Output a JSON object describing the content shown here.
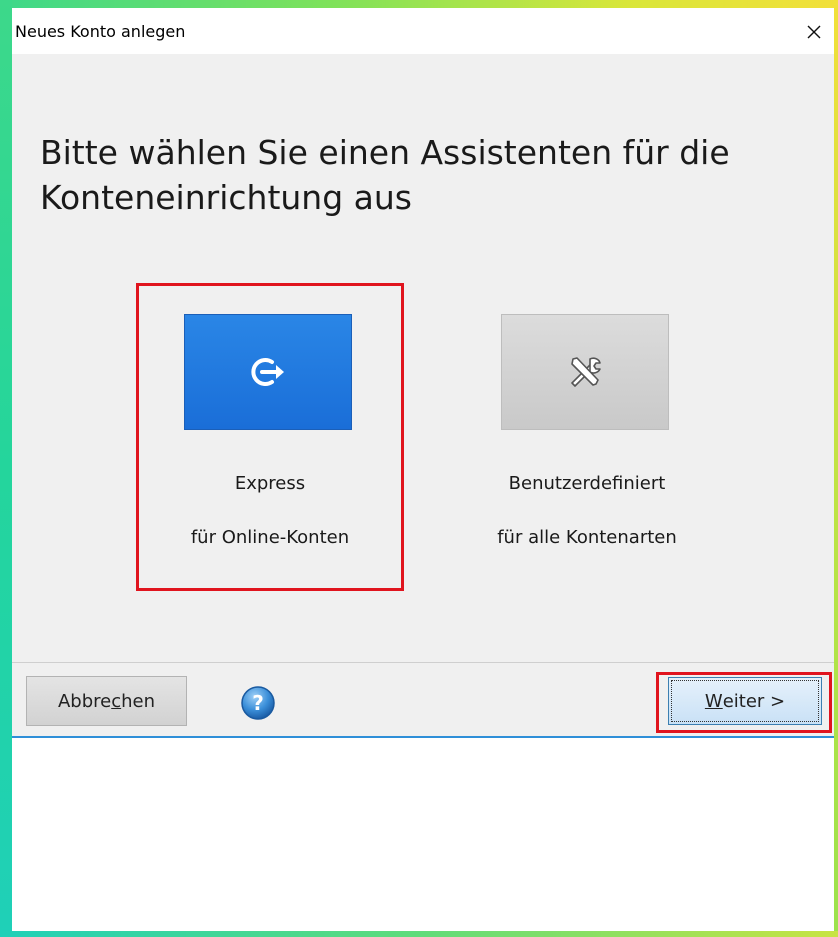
{
  "window": {
    "title": "Neues Konto anlegen",
    "close_icon": "close-icon"
  },
  "heading": {
    "line1": "Bitte wählen Sie einen Assistenten für die",
    "line2": "Konteneinrichtung aus"
  },
  "options": [
    {
      "icon": "sign-in-arrow-icon",
      "title": "Express",
      "subtitle": "für Online-Konten",
      "selected": true,
      "color": "#1a6ed8"
    },
    {
      "icon": "tools-icon",
      "title": "Benutzerdefiniert",
      "subtitle": "für alle Kontenarten",
      "selected": false,
      "color": "#cfcfcf"
    }
  ],
  "footer": {
    "cancel": {
      "before": "Abbre",
      "mnemonic": "c",
      "after": "hen"
    },
    "help_icon": "help-icon",
    "next": {
      "before": "",
      "mnemonic": "W",
      "after": "eiter >"
    }
  },
  "colors": {
    "highlight": "#e0141e",
    "accent": "#2f8fd8"
  }
}
